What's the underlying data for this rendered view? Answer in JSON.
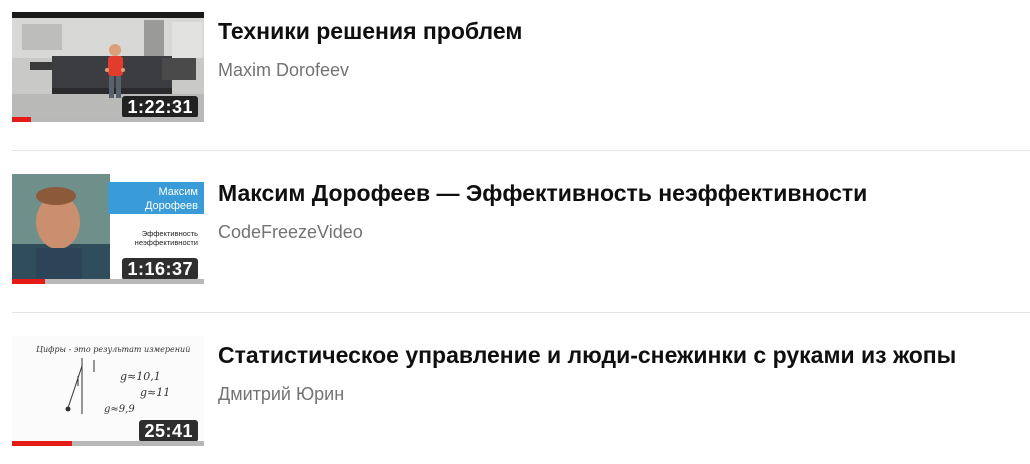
{
  "videos": [
    {
      "title": "Техники решения проблем",
      "channel": "Maxim Dorofeev",
      "duration": "1:22:31",
      "progress": 0.1,
      "thumbnail": {
        "kind": "office-scene",
        "icon": "video-thumbnail"
      }
    },
    {
      "title": "Максим Дорофеев — Эффективность неэффективности",
      "channel": "CodeFreezeVideo",
      "duration": "1:16:37",
      "progress": 0.17,
      "thumbnail": {
        "kind": "speaker-slide",
        "banner_line1": "Максим",
        "banner_line2": "Дорофеев",
        "caption_line1": "Эффективность",
        "caption_line2": "неэффективности",
        "accent": "#3a9bd9"
      }
    },
    {
      "title": "Статистическое управление и люди-снежинки с руками из жопы",
      "channel": "Дмитрий Юрин",
      "duration": "25:41",
      "progress": 0.31,
      "thumbnail": {
        "kind": "whiteboard-sketch",
        "caption": "Цифры - это результат измерений",
        "note1": "g≈10,1",
        "note2": "g≈11",
        "note3": "g≈9,9"
      }
    }
  ],
  "colors": {
    "progress_fill": "#e41b17",
    "progress_track": "#b8b8b8",
    "title": "#0f0f0f",
    "channel": "#737373"
  }
}
